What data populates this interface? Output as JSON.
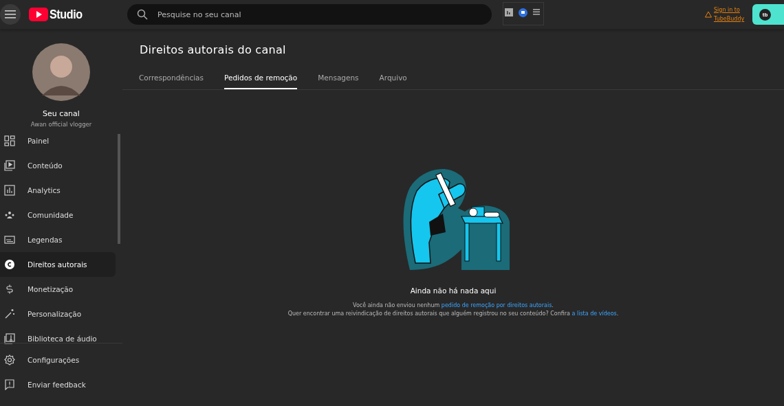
{
  "header": {
    "logo_text": "Studio",
    "search_placeholder": "Pesquise no seu canal",
    "signin_link": "Sign in to TubeBuddy",
    "tubebuddy_badge": "tb"
  },
  "sidebar": {
    "channel": {
      "title": "Seu canal",
      "name": "Awan official vlogger"
    },
    "items": [
      {
        "label": "Painel",
        "selected": false
      },
      {
        "label": "Conteúdo",
        "selected": false
      },
      {
        "label": "Analytics",
        "selected": false
      },
      {
        "label": "Comunidade",
        "selected": false
      },
      {
        "label": "Legendas",
        "selected": false
      },
      {
        "label": "Direitos autorais",
        "selected": true
      },
      {
        "label": "Monetização",
        "selected": false
      },
      {
        "label": "Personalização",
        "selected": false
      },
      {
        "label": "Biblioteca de áudio",
        "selected": false
      }
    ],
    "footer_items": [
      {
        "label": "Configurações"
      },
      {
        "label": "Enviar feedback"
      }
    ]
  },
  "page": {
    "title": "Direitos autorais do canal",
    "tabs": [
      {
        "label": "Correspondências",
        "selected": false
      },
      {
        "label": "Pedidos de remoção",
        "selected": true
      },
      {
        "label": "Mensagens",
        "selected": false
      },
      {
        "label": "Arquivo",
        "selected": false
      }
    ],
    "empty": {
      "heading": "Ainda não há nada aqui",
      "lines": [
        {
          "text": "Você ainda não enviou nenhum ",
          "link": "pedido de remoção por direitos autorais",
          "after": "."
        },
        {
          "text": "Quer encontrar uma reivindicação de direitos autorais que alguém registrou no seu conteúdo? Confira ",
          "link": "a lista de vídeos",
          "after": "."
        }
      ]
    }
  }
}
